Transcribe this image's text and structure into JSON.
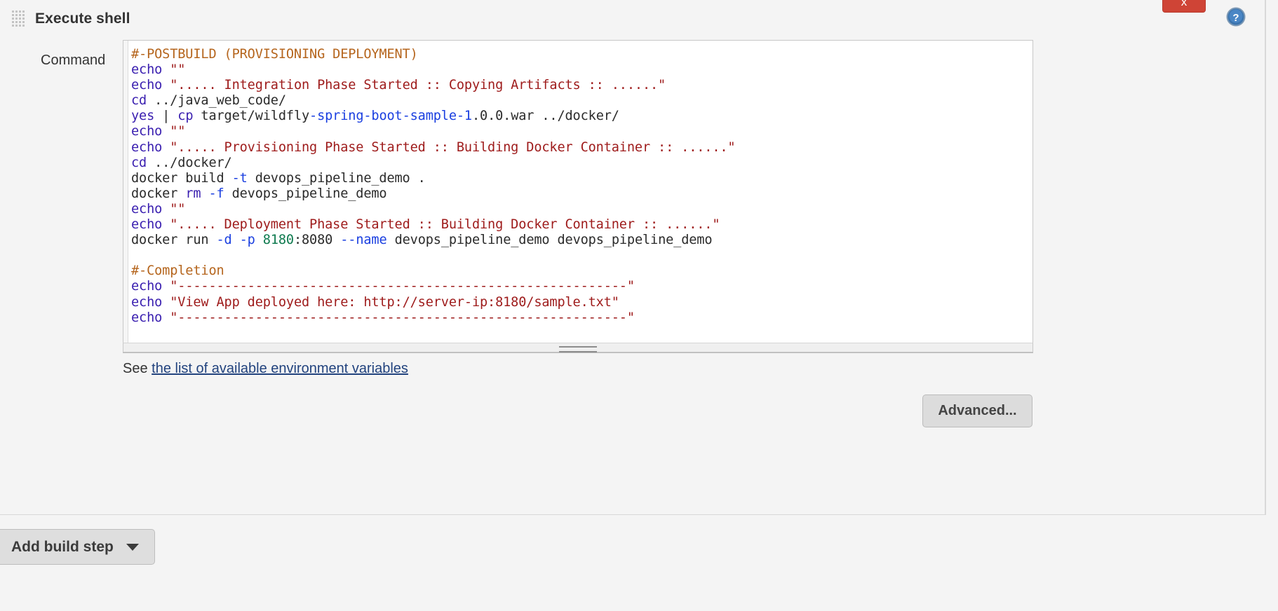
{
  "panel": {
    "title": "Execute shell",
    "drag_handle_icon": "grip-dots-icon",
    "close_label": "x",
    "help_icon": "help-question-icon"
  },
  "command": {
    "label": "Command",
    "value": "#-POSTBUILD (PROVISIONING DEPLOYMENT)\necho \"\"\necho \"..... Integration Phase Started :: Copying Artifacts :: ......\"\ncd ../java_web_code/\nyes | cp target/wildfly-spring-boot-sample-1.0.0.war ../docker/\necho \"\"\necho \"..... Provisioning Phase Started :: Building Docker Container :: ......\"\ncd ../docker/\ndocker build -t devops_pipeline_demo .\ndocker rm -f devops_pipeline_demo\necho \"\"\necho \"..... Deployment Phase Started :: Building Docker Container :: ......\"\ndocker run -d -p 8180:8080 --name devops_pipeline_demo devops_pipeline_demo\n\n#-Completion\necho \"----------------------------------------------------------\"\necho \"View App deployed here: http://server-ip:8180/sample.txt\"\necho \"----------------------------------------------------------\"",
    "lines": [
      {
        "tokens": [
          {
            "t": "#-POSTBUILD (PROVISIONING DEPLOYMENT)",
            "c": "tok-comment"
          }
        ]
      },
      {
        "tokens": [
          {
            "t": "echo",
            "c": "tok-kw"
          },
          {
            "t": " ",
            "c": "tok-plain"
          },
          {
            "t": "\"\"",
            "c": "tok-str"
          }
        ]
      },
      {
        "tokens": [
          {
            "t": "echo",
            "c": "tok-kw"
          },
          {
            "t": " ",
            "c": "tok-plain"
          },
          {
            "t": "\"..... Integration Phase Started :: Copying Artifacts :: ......\"",
            "c": "tok-str"
          }
        ]
      },
      {
        "tokens": [
          {
            "t": "cd",
            "c": "tok-kw"
          },
          {
            "t": " ../java_web_code/",
            "c": "tok-plain"
          }
        ]
      },
      {
        "tokens": [
          {
            "t": "yes",
            "c": "tok-kw"
          },
          {
            "t": " | ",
            "c": "tok-plain"
          },
          {
            "t": "cp",
            "c": "tok-kw"
          },
          {
            "t": " target/wildfly",
            "c": "tok-plain"
          },
          {
            "t": "-spring-boot-sample-1",
            "c": "tok-opt"
          },
          {
            "t": ".0.0.war ../docker/",
            "c": "tok-plain"
          }
        ]
      },
      {
        "tokens": [
          {
            "t": "echo",
            "c": "tok-kw"
          },
          {
            "t": " ",
            "c": "tok-plain"
          },
          {
            "t": "\"\"",
            "c": "tok-str"
          }
        ]
      },
      {
        "tokens": [
          {
            "t": "echo",
            "c": "tok-kw"
          },
          {
            "t": " ",
            "c": "tok-plain"
          },
          {
            "t": "\"..... Provisioning Phase Started :: Building Docker Container :: ......\"",
            "c": "tok-str"
          }
        ]
      },
      {
        "tokens": [
          {
            "t": "cd",
            "c": "tok-kw"
          },
          {
            "t": " ../docker/",
            "c": "tok-plain"
          }
        ]
      },
      {
        "tokens": [
          {
            "t": "docker build ",
            "c": "tok-plain"
          },
          {
            "t": "-t",
            "c": "tok-opt"
          },
          {
            "t": " devops_pipeline_demo .",
            "c": "tok-plain"
          }
        ]
      },
      {
        "tokens": [
          {
            "t": "docker ",
            "c": "tok-plain"
          },
          {
            "t": "rm",
            "c": "tok-kw"
          },
          {
            "t": " ",
            "c": "tok-plain"
          },
          {
            "t": "-f",
            "c": "tok-opt"
          },
          {
            "t": " devops_pipeline_demo",
            "c": "tok-plain"
          }
        ]
      },
      {
        "tokens": [
          {
            "t": "echo",
            "c": "tok-kw"
          },
          {
            "t": " ",
            "c": "tok-plain"
          },
          {
            "t": "\"\"",
            "c": "tok-str"
          }
        ]
      },
      {
        "tokens": [
          {
            "t": "echo",
            "c": "tok-kw"
          },
          {
            "t": " ",
            "c": "tok-plain"
          },
          {
            "t": "\"..... Deployment Phase Started :: Building Docker Container :: ......\"",
            "c": "tok-str"
          }
        ]
      },
      {
        "tokens": [
          {
            "t": "docker run ",
            "c": "tok-plain"
          },
          {
            "t": "-d",
            "c": "tok-opt"
          },
          {
            "t": " ",
            "c": "tok-plain"
          },
          {
            "t": "-p",
            "c": "tok-opt"
          },
          {
            "t": " ",
            "c": "tok-plain"
          },
          {
            "t": "8180",
            "c": "tok-num"
          },
          {
            "t": ":8080 ",
            "c": "tok-plain"
          },
          {
            "t": "--name",
            "c": "tok-opt"
          },
          {
            "t": " devops_pipeline_demo devops_pipeline_demo",
            "c": "tok-plain"
          }
        ]
      },
      {
        "tokens": [
          {
            "t": "",
            "c": "tok-plain"
          }
        ]
      },
      {
        "tokens": [
          {
            "t": "#-Completion",
            "c": "tok-comment"
          }
        ]
      },
      {
        "tokens": [
          {
            "t": "echo",
            "c": "tok-kw"
          },
          {
            "t": " ",
            "c": "tok-plain"
          },
          {
            "t": "\"----------------------------------------------------------\"",
            "c": "tok-str"
          }
        ]
      },
      {
        "tokens": [
          {
            "t": "echo",
            "c": "tok-kw"
          },
          {
            "t": " ",
            "c": "tok-plain"
          },
          {
            "t": "\"View App deployed here: http://server-ip:8180/sample.txt\"",
            "c": "tok-str"
          }
        ]
      },
      {
        "tokens": [
          {
            "t": "echo",
            "c": "tok-kw"
          },
          {
            "t": " ",
            "c": "tok-plain"
          },
          {
            "t": "\"----------------------------------------------------------\"",
            "c": "tok-str"
          }
        ]
      }
    ]
  },
  "env_hint": {
    "prefix": "See ",
    "link_text": "the list of available environment variables"
  },
  "buttons": {
    "advanced": "Advanced...",
    "add_build_step": "Add build step",
    "add_build_step_caret": "chevron-down-icon"
  },
  "colors": {
    "close_red": "#cf4436",
    "link_blue": "#22437e",
    "help_blue": "#3b74ae",
    "comment": "#b5651d",
    "keyword": "#3a1fb0",
    "string": "#9e1b1b",
    "option": "#1a3fe0",
    "number": "#0f7a4f"
  }
}
